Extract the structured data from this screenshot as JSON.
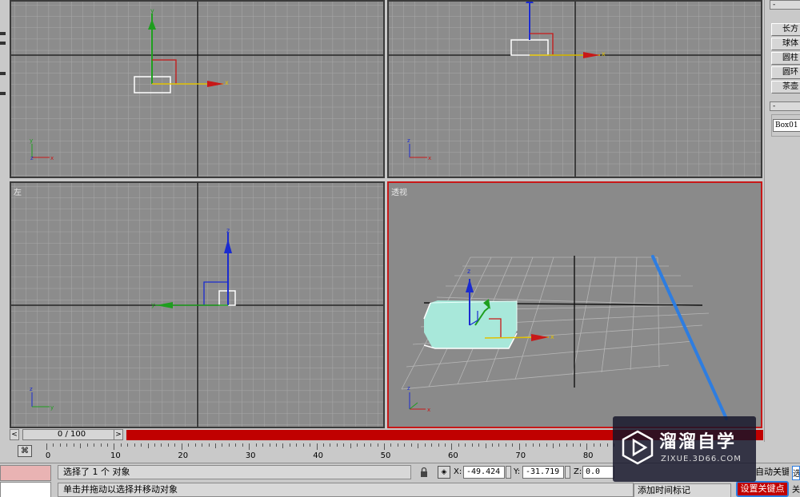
{
  "viewports": {
    "top_left": {
      "label": ""
    },
    "top_right": {
      "label": ""
    },
    "left": {
      "label": "左"
    },
    "perspective": {
      "label": "透视"
    }
  },
  "axis_labels": {
    "x": "x",
    "y": "y",
    "z": "z"
  },
  "command_panel": {
    "rollout1": "-",
    "buttons": [
      "长方",
      "球体",
      "圆柱",
      "圆环",
      "茶壶"
    ],
    "rollout2": "-",
    "object_name": "Box01"
  },
  "time_slider": {
    "prev": "<",
    "frame_display": "0 / 100",
    "next": ">",
    "current": 0,
    "total": 100
  },
  "track_bar": {
    "icon": "filter-icon",
    "ticks": [
      "0",
      "10",
      "20",
      "30",
      "40",
      "50",
      "60",
      "70",
      "80"
    ]
  },
  "status_bar": {
    "selection_message": "选择了 1 个 对象",
    "prompt_message": "单击并拖动以选择并移动对象",
    "lock_icon": "lock-icon",
    "abs_icon": "absolute-mode-icon",
    "coords": {
      "x_label": "X:",
      "x_value": "-49.424",
      "y_label": "Y:",
      "y_value": "-31.719",
      "z_label": "Z:",
      "z_value": "0.0"
    },
    "auto_key_partial": "自动关键点",
    "add_time_tag": "添加时间标记",
    "set_key": "设置关键点",
    "filters_partial": "选",
    "close_partial": "关"
  },
  "watermark": {
    "title": "溜溜自学",
    "url": "ZIXUE.3D66.COM"
  },
  "colors": {
    "active_viewport": "#c81818",
    "timebar_red": "#c00000",
    "setkey_border": "#2e7de0",
    "box_fill": "#a8e8da"
  }
}
